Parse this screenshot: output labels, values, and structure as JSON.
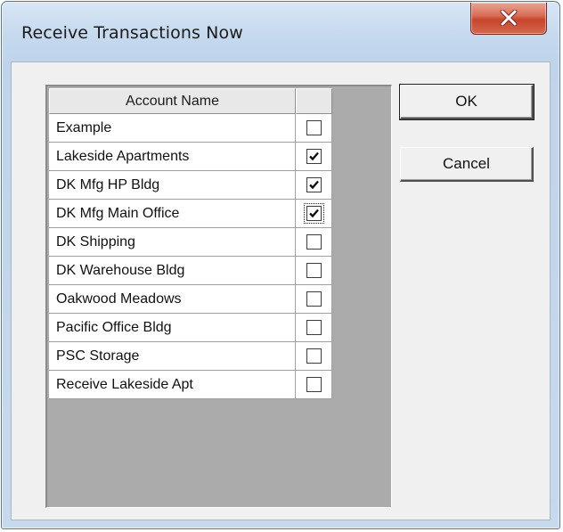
{
  "window": {
    "title": "Receive Transactions Now"
  },
  "grid": {
    "header_name": "Account Name",
    "header_check": "",
    "rows": [
      {
        "name": "Example",
        "checked": false,
        "focused": false
      },
      {
        "name": "Lakeside Apartments",
        "checked": true,
        "focused": false
      },
      {
        "name": "DK Mfg HP Bldg",
        "checked": true,
        "focused": false
      },
      {
        "name": "DK Mfg Main Office",
        "checked": true,
        "focused": true
      },
      {
        "name": "DK Shipping",
        "checked": false,
        "focused": false
      },
      {
        "name": "DK Warehouse Bldg",
        "checked": false,
        "focused": false
      },
      {
        "name": "Oakwood Meadows",
        "checked": false,
        "focused": false
      },
      {
        "name": "Pacific Office Bldg",
        "checked": false,
        "focused": false
      },
      {
        "name": "PSC Storage",
        "checked": false,
        "focused": false
      },
      {
        "name": "Receive Lakeside Apt",
        "checked": false,
        "focused": false
      }
    ]
  },
  "buttons": {
    "ok_label": "OK",
    "cancel_label": "Cancel"
  },
  "icons": {
    "close": "close-icon",
    "check": "checkmark-icon"
  },
  "colors": {
    "close_button": "#c7452c",
    "title_bar": "#c4d8ee",
    "list_background": "#ababab"
  }
}
